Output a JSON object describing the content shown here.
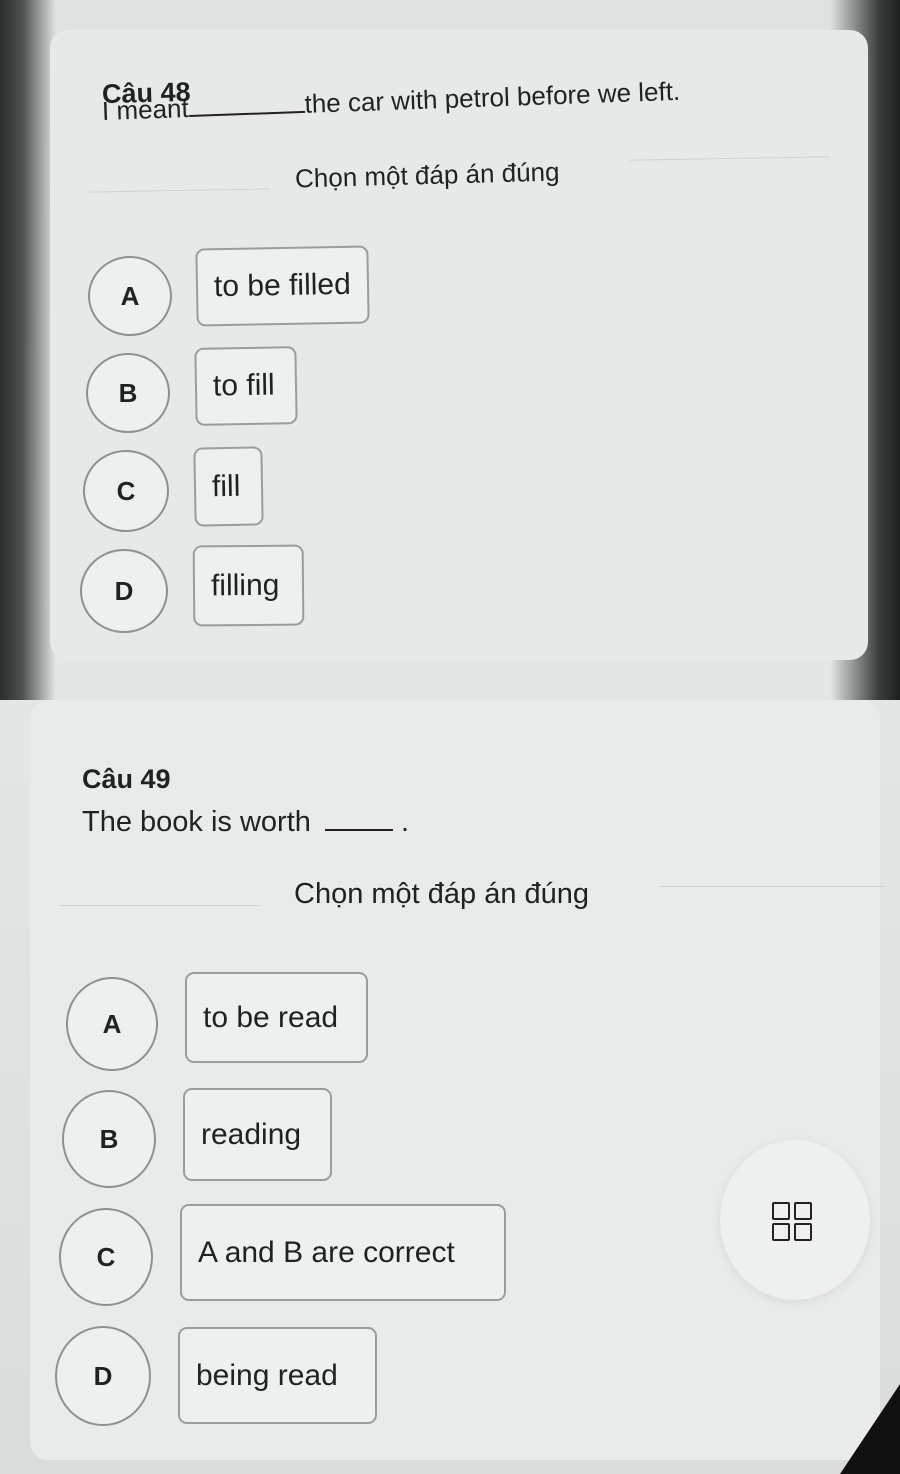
{
  "q48": {
    "number": "Câu 48",
    "text_before": "I meant",
    "text_after": "the car with petrol before we left.",
    "instruction": "Chọn một đáp án đúng",
    "options": [
      {
        "letter": "A",
        "text": "to be filled"
      },
      {
        "letter": "B",
        "text": "to fill"
      },
      {
        "letter": "C",
        "text": "fill"
      },
      {
        "letter": "D",
        "text": "filling"
      }
    ]
  },
  "q49": {
    "number": "Câu 49",
    "text_before": "The book is worth",
    "text_after": ".",
    "instruction": "Chọn một đáp án đúng",
    "options": [
      {
        "letter": "A",
        "text": "to be read"
      },
      {
        "letter": "B",
        "text": "reading"
      },
      {
        "letter": "C",
        "text": "A and B are correct"
      },
      {
        "letter": "D",
        "text": "being read"
      }
    ]
  },
  "fab": {
    "icon": "grid-icon"
  }
}
